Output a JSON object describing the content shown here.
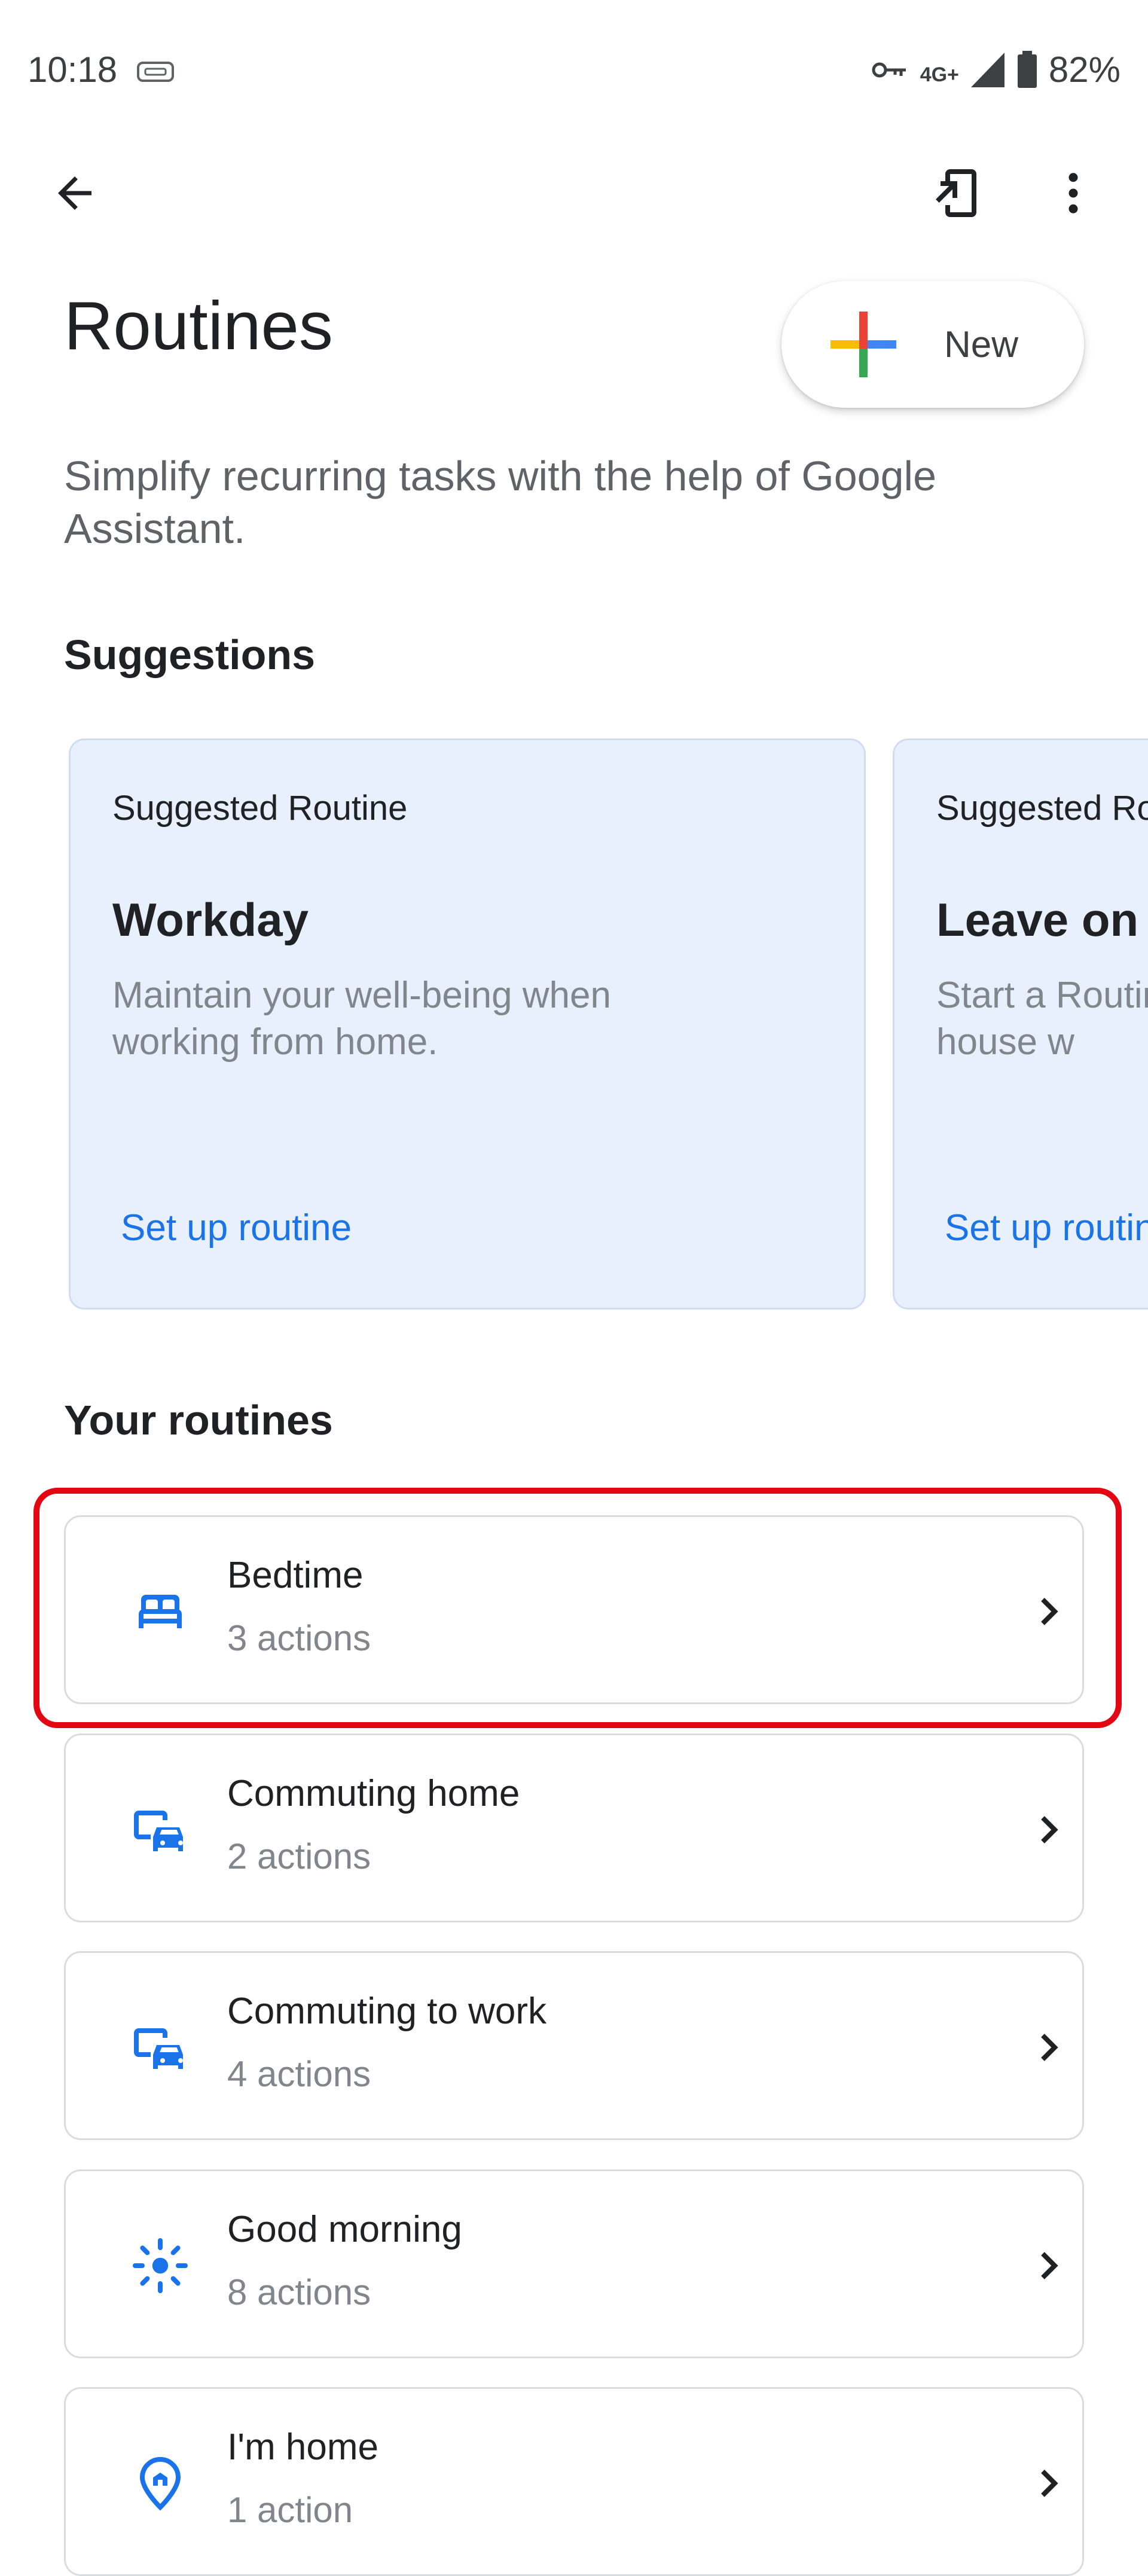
{
  "status_bar": {
    "time": "10:18",
    "network": "4G+",
    "battery": "82%"
  },
  "header": {
    "title": "Routines",
    "new_label": "New"
  },
  "subtitle": "Simplify recurring tasks with the help of Google Assistant.",
  "suggestions": {
    "heading": "Suggestions",
    "cards": [
      {
        "kicker": "Suggested Routine",
        "name": "Workday",
        "description": "Maintain your well-being when working from home.",
        "cta": "Set up routine"
      },
      {
        "kicker": "Suggested Routine",
        "name": "Leave on t",
        "description": "Start a Routine when you leave the house w",
        "cta": "Set up routine"
      }
    ]
  },
  "your_routines": {
    "heading": "Your routines",
    "items": [
      {
        "name": "Bedtime",
        "count": "3 actions",
        "icon": "bed-icon"
      },
      {
        "name": "Commuting home",
        "count": "2 actions",
        "icon": "commute-icon"
      },
      {
        "name": "Commuting to work",
        "count": "4 actions",
        "icon": "commute-icon"
      },
      {
        "name": "Good morning",
        "count": "8 actions",
        "icon": "sun-icon"
      },
      {
        "name": "I'm home",
        "count": "1 action",
        "icon": "home-pin-icon"
      }
    ]
  },
  "colors": {
    "accent": "#1a73e8",
    "card_bg": "#e8f0fe",
    "highlight": "#e30613"
  }
}
